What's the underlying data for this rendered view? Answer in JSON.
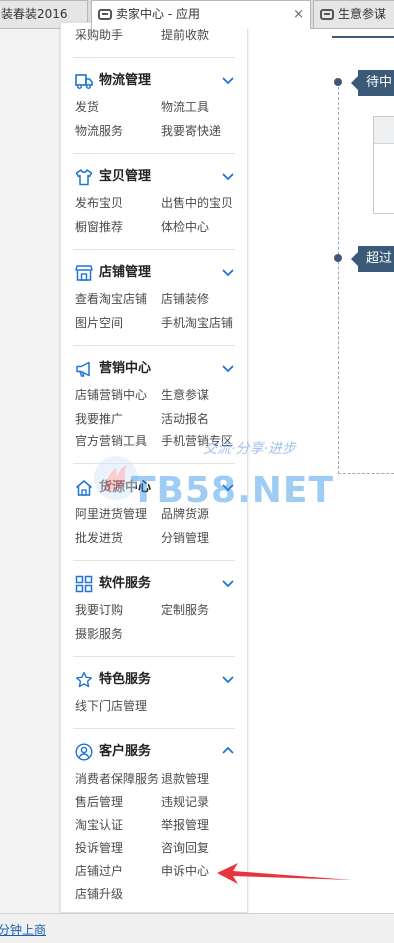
{
  "browser": {
    "tabs": [
      {
        "title": "装春装2016",
        "active": false
      },
      {
        "title": "卖家中心 - 应用",
        "active": true,
        "close": "×"
      },
      {
        "title": "生意参谋",
        "active": false
      }
    ]
  },
  "sidebar": {
    "top_links": [
      "采购助手",
      "提前收款"
    ],
    "groups": [
      {
        "title": "物流管理",
        "icon": "truck-icon",
        "expanded": false,
        "links": [
          "发货",
          "物流工具",
          "物流服务",
          "我要寄快递"
        ]
      },
      {
        "title": "宝贝管理",
        "icon": "shirt-icon",
        "expanded": false,
        "links": [
          "发布宝贝",
          "出售中的宝贝",
          "橱窗推荐",
          "体检中心"
        ]
      },
      {
        "title": "店铺管理",
        "icon": "store-icon",
        "expanded": false,
        "links": [
          "查看淘宝店铺",
          "店铺装修",
          "图片空间",
          "手机淘宝店铺"
        ]
      },
      {
        "title": "营销中心",
        "icon": "megaphone-icon",
        "expanded": false,
        "links": [
          "店铺营销中心",
          "生意参谋",
          "我要推广",
          "活动报名",
          "官方营销工具",
          "手机营销专区"
        ]
      },
      {
        "title": "货源中心",
        "icon": "house-icon",
        "expanded": false,
        "links": [
          "阿里进货管理",
          "品牌货源",
          "批发进货",
          "分销管理"
        ]
      },
      {
        "title": "软件服务",
        "icon": "grid-icon",
        "expanded": false,
        "links": [
          "我要订购",
          "定制服务",
          "摄影服务"
        ]
      },
      {
        "title": "特色服务",
        "icon": "star-icon",
        "expanded": false,
        "links": [
          "线下门店管理"
        ]
      },
      {
        "title": "客户服务",
        "icon": "user-icon",
        "expanded": true,
        "links": [
          "消费者保障服务",
          "退款管理",
          "售后管理",
          "违规记录",
          "淘宝认证",
          "举报管理",
          "投诉管理",
          "咨询回复",
          "店铺过户",
          "申诉中心",
          "店铺升级"
        ]
      }
    ]
  },
  "timeline": {
    "items": [
      {
        "label": "待中"
      },
      {
        "label": "超过"
      }
    ]
  },
  "watermark": {
    "text": "TB58.NET",
    "slogan": "交流·分享·进步"
  },
  "status_bar": {
    "link": "分钟上商"
  },
  "colors": {
    "accent": "#1f74d4",
    "tag": "#3a5a77",
    "arrow": "#e8343a"
  }
}
